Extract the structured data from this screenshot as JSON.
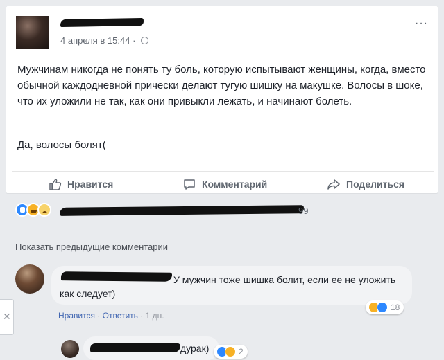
{
  "post": {
    "time": "4 апреля в 15:44",
    "separator": "·",
    "more": "···",
    "body": "Мужчинам никогда не понять ту боль, которую испытывают женщины, когда, вместо обычной каждодневной прически делают тугую шишку на макушке. Волосы в шоке, что их уложили не так, как они привыкли лежать, и начинают болеть.",
    "body2": "Да, волосы болят("
  },
  "actions": {
    "like": "Нравится",
    "comment": "Комментарий",
    "share": "Поделиться"
  },
  "reactions": {
    "count": "99",
    "icons": [
      "like-icon",
      "haha-icon",
      "sad-icon"
    ]
  },
  "comments": {
    "show_previous": "Показать предыдущие комментарии",
    "items": [
      {
        "text": "У мужчин тоже шишка болит, если ее не уложить как следует)",
        "reaction_count": "18",
        "like": "Нравится",
        "reply": "Ответить",
        "dot": "·",
        "time": "1 дн."
      },
      {
        "text": "дурак)",
        "reaction_count": "2"
      }
    ]
  },
  "sidebar": {
    "close": "✕"
  },
  "colors": {
    "link": "#4267b2",
    "like_blue": "#2d88ff",
    "haha_yellow": "#f7b125",
    "muted": "#90949c"
  }
}
